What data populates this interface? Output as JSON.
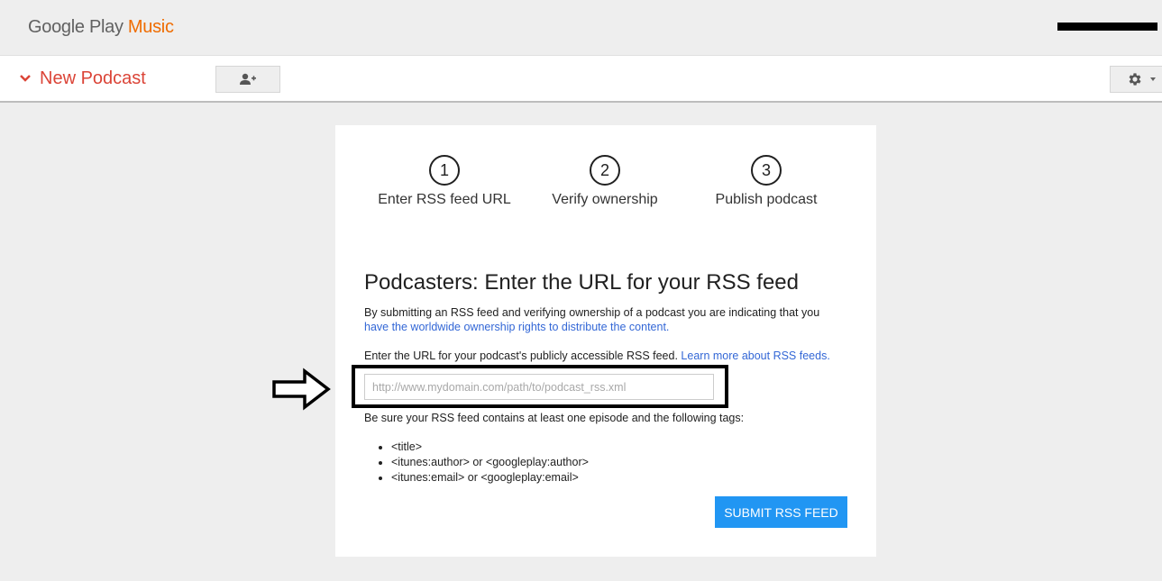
{
  "app": {
    "logo_prefix": "Google Play",
    "logo_suffix": "Music"
  },
  "toolbar": {
    "title": "New Podcast"
  },
  "icons": {
    "chevron": "chevron-down-icon",
    "share": "add-person-icon",
    "settings": "gear-icon",
    "arrow": "right-arrow-icon"
  },
  "steps": [
    {
      "number": "1",
      "label": "Enter RSS feed URL"
    },
    {
      "number": "2",
      "label": "Verify ownership"
    },
    {
      "number": "3",
      "label": "Publish podcast"
    }
  ],
  "form": {
    "heading": "Podcasters: Enter the URL for your RSS feed",
    "intro_text": "By submitting an RSS feed and verifying ownership of a podcast you are indicating that you",
    "intro_link": "have the worldwide ownership rights to distribute the content.",
    "url_prompt": "Enter the URL for your podcast's publicly accessible RSS feed.",
    "url_prompt_link": "Learn more about RSS feeds.",
    "url_value": "",
    "url_placeholder": "http://www.mydomain.com/path/to/podcast_rss.xml",
    "tags_intro": "Be sure your RSS feed contains at least one episode and the following tags:",
    "tags": [
      "<title>",
      "<itunes:author> or <googleplay:author>",
      "<itunes:email> or <googleplay:email>"
    ],
    "submit_label": "Submit RSS Feed"
  },
  "colors": {
    "accent_red": "#db4437",
    "music_orange": "#ef6c00",
    "link_blue": "#3367d6",
    "button_blue": "#2196f3"
  }
}
